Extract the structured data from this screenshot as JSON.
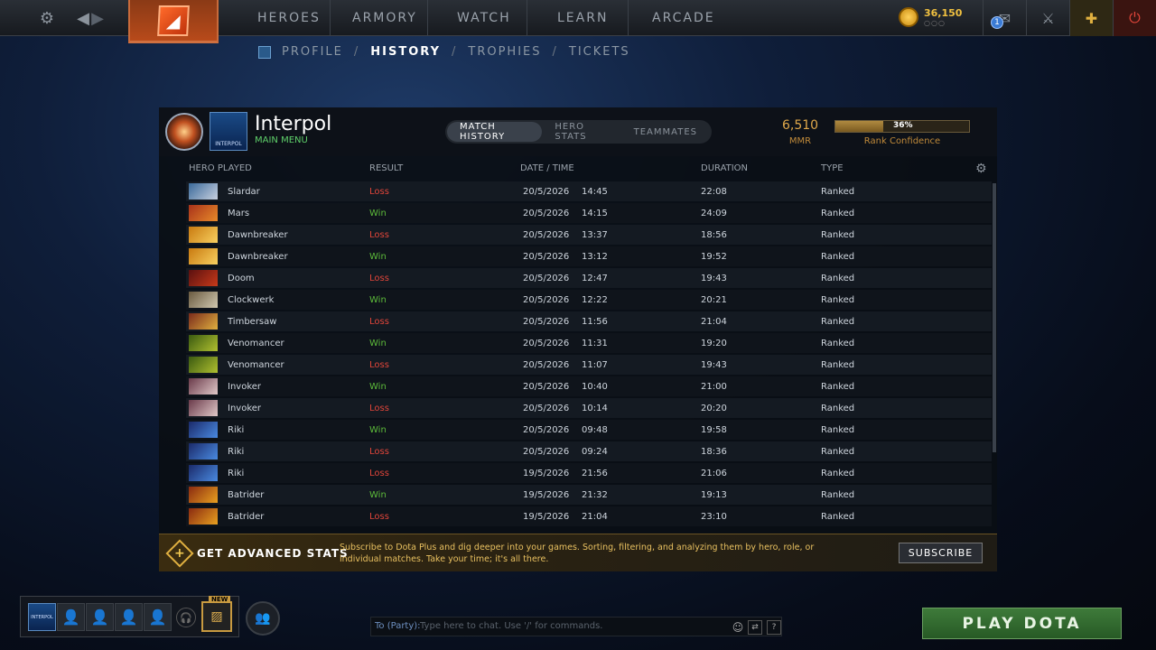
{
  "nav": {
    "items": [
      "HEROES",
      "ARMORY",
      "WATCH",
      "LEARN",
      "ARCADE"
    ],
    "gold": "36,150",
    "gold_dots": "○○○",
    "mail_badge": "1"
  },
  "subnav": {
    "items": [
      "PROFILE",
      "HISTORY",
      "TROPHIES",
      "TICKETS"
    ],
    "sep": "/"
  },
  "profile": {
    "name": "Interpol",
    "status": "MAIN MENU",
    "avatar_text": "INTERPOL",
    "mmr": "6,510",
    "mmr_label": "MMR",
    "confidence": 0.36,
    "confidence_text": "36%",
    "confidence_label": "Rank Confidence"
  },
  "tabs": [
    "MATCH HISTORY",
    "HERO STATS",
    "TEAMMATES"
  ],
  "table": {
    "headers": [
      "HERO PLAYED",
      "RESULT",
      "DATE / TIME",
      "DURATION",
      "TYPE"
    ],
    "rows": [
      {
        "hero": "Slardar",
        "result": "Loss",
        "date": "20/5/2026",
        "time": "14:45",
        "duration": "22:08",
        "type": "Ranked",
        "c1": "#3a6a9a",
        "c2": "#c8d0e0"
      },
      {
        "hero": "Mars",
        "result": "Win",
        "date": "20/5/2026",
        "time": "14:15",
        "duration": "24:09",
        "type": "Ranked",
        "c1": "#a8321a",
        "c2": "#e88a2a"
      },
      {
        "hero": "Dawnbreaker",
        "result": "Loss",
        "date": "20/5/2026",
        "time": "13:37",
        "duration": "18:56",
        "type": "Ranked",
        "c1": "#c87a10",
        "c2": "#f8d060"
      },
      {
        "hero": "Dawnbreaker",
        "result": "Win",
        "date": "20/5/2026",
        "time": "13:12",
        "duration": "19:52",
        "type": "Ranked",
        "c1": "#c87a10",
        "c2": "#f8d060"
      },
      {
        "hero": "Doom",
        "result": "Loss",
        "date": "20/5/2026",
        "time": "12:47",
        "duration": "19:43",
        "type": "Ranked",
        "c1": "#5a1010",
        "c2": "#c83a1a"
      },
      {
        "hero": "Clockwerk",
        "result": "Win",
        "date": "20/5/2026",
        "time": "12:22",
        "duration": "20:21",
        "type": "Ranked",
        "c1": "#6a5a40",
        "c2": "#d0c8b0"
      },
      {
        "hero": "Timbersaw",
        "result": "Loss",
        "date": "20/5/2026",
        "time": "11:56",
        "duration": "21:04",
        "type": "Ranked",
        "c1": "#7a2a1a",
        "c2": "#e0b040"
      },
      {
        "hero": "Venomancer",
        "result": "Win",
        "date": "20/5/2026",
        "time": "11:31",
        "duration": "19:20",
        "type": "Ranked",
        "c1": "#3a5a10",
        "c2": "#b0c030"
      },
      {
        "hero": "Venomancer",
        "result": "Loss",
        "date": "20/5/2026",
        "time": "11:07",
        "duration": "19:43",
        "type": "Ranked",
        "c1": "#3a5a10",
        "c2": "#b0c030"
      },
      {
        "hero": "Invoker",
        "result": "Win",
        "date": "20/5/2026",
        "time": "10:40",
        "duration": "21:00",
        "type": "Ranked",
        "c1": "#6a3a4a",
        "c2": "#e0c8c8"
      },
      {
        "hero": "Invoker",
        "result": "Loss",
        "date": "20/5/2026",
        "time": "10:14",
        "duration": "20:20",
        "type": "Ranked",
        "c1": "#6a3a4a",
        "c2": "#e0c8c8"
      },
      {
        "hero": "Riki",
        "result": "Win",
        "date": "20/5/2026",
        "time": "09:48",
        "duration": "19:58",
        "type": "Ranked",
        "c1": "#1a2a6a",
        "c2": "#4a8ae0"
      },
      {
        "hero": "Riki",
        "result": "Loss",
        "date": "20/5/2026",
        "time": "09:24",
        "duration": "18:36",
        "type": "Ranked",
        "c1": "#1a2a6a",
        "c2": "#4a8ae0"
      },
      {
        "hero": "Riki",
        "result": "Loss",
        "date": "19/5/2026",
        "time": "21:56",
        "duration": "21:06",
        "type": "Ranked",
        "c1": "#1a2a6a",
        "c2": "#4a8ae0"
      },
      {
        "hero": "Batrider",
        "result": "Win",
        "date": "19/5/2026",
        "time": "21:32",
        "duration": "19:13",
        "type": "Ranked",
        "c1": "#8a2a10",
        "c2": "#e8a020"
      },
      {
        "hero": "Batrider",
        "result": "Loss",
        "date": "19/5/2026",
        "time": "21:04",
        "duration": "23:10",
        "type": "Ranked",
        "c1": "#8a2a10",
        "c2": "#e8a020"
      }
    ]
  },
  "banner": {
    "title": "GET ADVANCED STATS",
    "text": "Subscribe to Dota Plus and dig deeper into your games. Sorting, filtering, and analyzing them by hero, role, or individual matches. Take your time; it's all there.",
    "button": "SUBSCRIBE"
  },
  "footer": {
    "new_label": "NEW",
    "chat_label": "To (Party):",
    "chat_placeholder": "Type here to chat. Use '/' for commands.",
    "help": "?",
    "play": "PLAY DOTA"
  },
  "colors": {
    "loss": "#e0453a",
    "win": "#5dbb3a",
    "accent": "#e0a84a",
    "play": "#3e7a3a"
  }
}
